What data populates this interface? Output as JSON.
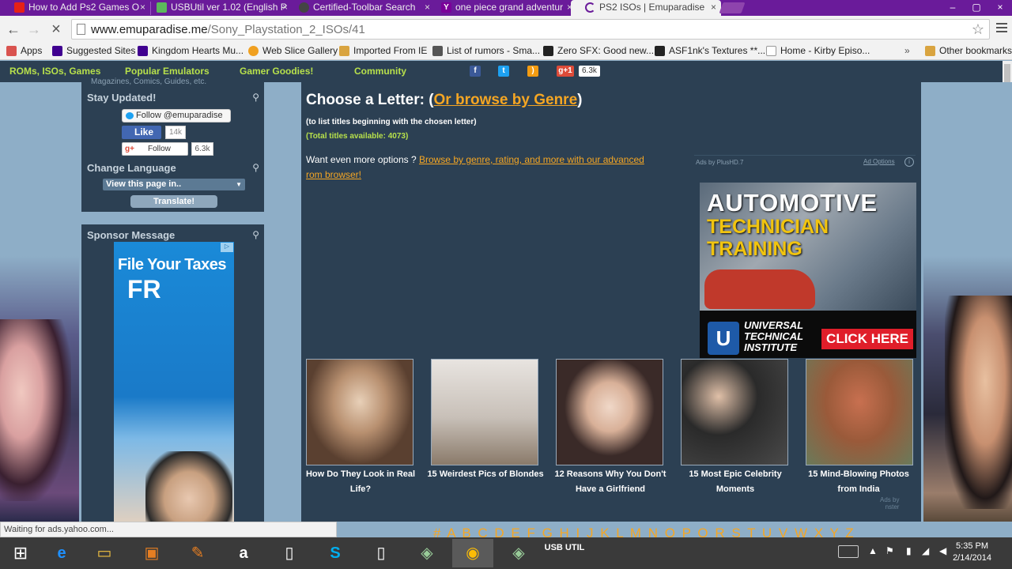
{
  "browser": {
    "tabs": [
      {
        "title": "How to Add Ps2 Games O",
        "icon_color": "#e62117"
      },
      {
        "title": "USBUtil ver 1.02 (English P",
        "icon_color": "#5cb85c"
      },
      {
        "title": "Certified-Toolbar Search",
        "icon_color": "#444444"
      },
      {
        "title": "one piece grand adventur",
        "icon_color": "#7b0099"
      },
      {
        "title": "PS2 ISOs | Emuparadise",
        "icon_color": "#6a1b9a"
      }
    ],
    "url_host": "www.emuparadise.me",
    "url_path": "/Sony_Playstation_2_ISOs/41",
    "bookmarks": [
      {
        "label": "Apps",
        "icon_color": "#d9534f"
      },
      {
        "label": "Suggested Sites",
        "icon_color": "#400090"
      },
      {
        "label": "Kingdom Hearts Mu...",
        "icon_color": "#400090"
      },
      {
        "label": "Web Slice Gallery",
        "icon_color": "#f0a020"
      },
      {
        "label": "Imported From IE",
        "icon_color": "#d9a440"
      },
      {
        "label": "List of rumors - Sma...",
        "icon_color": "#555555"
      },
      {
        "label": "Zero SFX: Good new...",
        "icon_color": "#222222"
      },
      {
        "label": "ASF1nk's Textures **...",
        "icon_color": "#222222"
      },
      {
        "label": "Home - Kirby Episo...",
        "icon_color": "#ffffff"
      },
      {
        "label": "Other bookmarks",
        "icon_color": "#d9a440"
      }
    ],
    "status_text": "Waiting for ads.yahoo.com..."
  },
  "site": {
    "nav": [
      "ROMs, ISOs, Games",
      "Popular Emulators",
      "Gamer Goodies!",
      "Community"
    ],
    "gplus_count": "6.3k",
    "sidebar": {
      "cut_text": "Magazines, Comics, Guides, etc.",
      "stay_updated": "Stay Updated!",
      "twitter_follow": "Follow @emuparadise",
      "fb_like": "Like",
      "fb_count": "14k",
      "gplus_follow": "Follow",
      "gplus_follow_count": "6.3k",
      "change_language": "Change Language",
      "lang_select": "View this page in..",
      "translate_button": "Translate!",
      "sponsor_title": "Sponsor Message",
      "tax_ad_line1": "File Your Taxes",
      "tax_ad_line2": "FR"
    },
    "main": {
      "choose_letter": "Choose a Letter: (",
      "browse_genre_link": "Or browse by Genre",
      "choose_close": ")",
      "hint": "(to list titles beginning with the chosen letter)",
      "total": "(Total titles available: 4073)",
      "want_more": "Want even more options ? ",
      "want_more_link": "Browse by genre, rating, and more with our advanced rom browser!",
      "ads_by": "Ads by PlusHD.7",
      "ad_options": "Ad Options",
      "ad_headline1": "AUTOMOTIVE",
      "ad_headline2": "TECHNICIAN",
      "ad_headline3": "TRAINING",
      "ad_brand": "UNIVERSAL TECHNICAL INSTITUTE",
      "ad_logo": "U",
      "ad_cta": "CLICK HERE",
      "thumbs": [
        {
          "caption": "How Do They Look in Real Life?",
          "bg": "#8a6a4a"
        },
        {
          "caption": "15 Weirdest Pics of Blondes",
          "bg": "#c8c0b8"
        },
        {
          "caption": "12 Reasons Why You Don't Have a Girlfriend",
          "bg": "#3a2a28"
        },
        {
          "caption": "15 Most Epic Celebrity Moments",
          "bg": "#4a4a4a"
        },
        {
          "caption": "15 Mind-Blowing Photos from India",
          "bg": "#9a5a3a"
        }
      ],
      "taboola_1": "Ads by",
      "taboola_2": "nster",
      "alphabet": "# A B C D E F G H I J K L M N O P Q R S T U V W X Y Z"
    }
  },
  "taskbar": {
    "time": "5:35 PM",
    "date": "2/14/2014",
    "usb_label": "USB UTIL"
  }
}
